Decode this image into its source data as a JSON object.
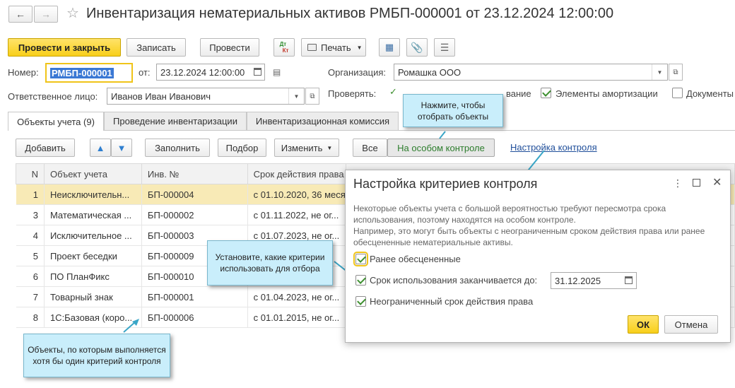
{
  "window": {
    "title": "Инвентаризация нематериальных активов РМБП-000001 от 23.12.2024 12:00:00"
  },
  "toolbar": {
    "post_close": "Провести и закрыть",
    "write": "Записать",
    "post": "Провести",
    "print": "Печать",
    "dt_kt": {
      "dt": "Дт",
      "kt": "Кт"
    }
  },
  "header": {
    "number_label": "Номер:",
    "number_value": "РМБП-000001",
    "date_label": "от:",
    "date_value": "23.12.2024 12:00:00",
    "org_label": "Организация:",
    "org_value": "Ромашка ООО",
    "resp_label": "Ответственное лицо:",
    "resp_value": "Иванов Иван Иванович",
    "check_label": "Проверять:",
    "check_items": [
      {
        "label": "вание",
        "checked": true
      },
      {
        "label": "Элементы амортизации",
        "checked": true
      },
      {
        "label": "Документы",
        "checked": false
      }
    ]
  },
  "tabs": [
    {
      "label": "Объекты учета (9)",
      "active": true
    },
    {
      "label": "Проведение инвентаризации",
      "active": false
    },
    {
      "label": "Инвентаризационная комиссия",
      "active": false
    }
  ],
  "list_toolbar": {
    "add": "Добавить",
    "fill": "Заполнить",
    "select": "Подбор",
    "change": "Изменить",
    "filter_all": "Все",
    "filter_special": "На особом контроле",
    "settings_link": "Настройка контроля"
  },
  "table": {
    "columns": [
      "N",
      "Объект учета",
      "Инв. №",
      "Срок действия права"
    ],
    "rows": [
      {
        "n": "1",
        "object": "Неисключительн...",
        "inv": "БП-000004",
        "term": "с 01.10.2020, 36 меся",
        "selected": true
      },
      {
        "n": "3",
        "object": "Математическая ...",
        "inv": "БП-000002",
        "term": "с 01.11.2022, не ог..."
      },
      {
        "n": "4",
        "object": "Исключительное ...",
        "inv": "БП-000003",
        "term": "с 01.07.2023, не ог..."
      },
      {
        "n": "5",
        "object": "Проект беседки",
        "inv": "БП-000009",
        "term": ""
      },
      {
        "n": "6",
        "object": "ПО ПланФикс",
        "inv": "БП-000010",
        "term": ""
      },
      {
        "n": "7",
        "object": "Товарный знак",
        "inv": "БП-000001",
        "term": "с 01.04.2023, не ог..."
      },
      {
        "n": "8",
        "object": "1С:Базовая (коро...",
        "inv": "БП-000006",
        "term": "с 01.01.2015, не ог..."
      }
    ]
  },
  "dialog": {
    "title": "Настройка критериев контроля",
    "description": "Некоторые объекты учета с большой вероятностью требуют пересмотра срока использования, поэтому находятся на особом контроле.\nНапример, это могут быть объекты с неограниченным сроком действия права или ранее обесцененные нематериальные активы.",
    "criteria": [
      {
        "label": "Ранее обесцененные",
        "checked": true
      },
      {
        "label": "Срок использования заканчивается до:",
        "checked": true
      },
      {
        "label": "Неограниченный срок действия права",
        "checked": true
      }
    ],
    "date_value": "31.12.2025",
    "ok": "ОК",
    "cancel": "Отмена"
  },
  "callouts": {
    "select_objects": "Нажмите, чтобы отобрать объекты",
    "set_criteria": "Установите, какие критерии использовать для отбора",
    "objects_note": "Объекты, по которым выполняется хотя бы один критерий контроля"
  }
}
